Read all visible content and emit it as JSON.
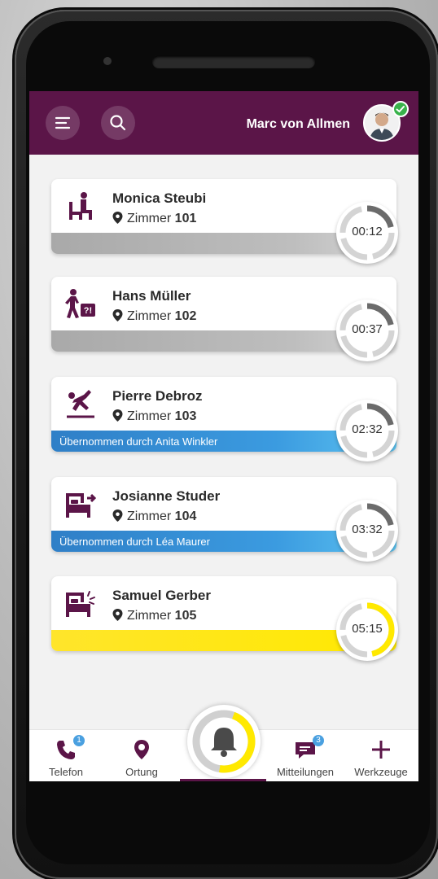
{
  "header": {
    "user_name": "Marc von Allmen",
    "menu_icon": "menu-icon",
    "search_icon": "search-icon",
    "status": "online"
  },
  "colors": {
    "brand": "#5b1548",
    "gray_bar": "#b0b0b0",
    "blue_bar": "#3b9be0",
    "yellow_bar": "#ffe900",
    "online": "#38b24a"
  },
  "alarms": [
    {
      "name": "Monica Steubi",
      "room_label": "Zimmer",
      "room_number": "101",
      "timer": "00:12",
      "status_text": "",
      "icon": "sitting-person-icon"
    },
    {
      "name": "Hans Müller",
      "room_label": "Zimmer",
      "room_number": "102",
      "timer": "00:37",
      "status_text": "",
      "icon": "walking-person-icon"
    },
    {
      "name": "Pierre Debroz",
      "room_label": "Zimmer",
      "room_number": "103",
      "timer": "02:32",
      "status_text": "Übernommen durch Anita Winkler",
      "icon": "fall-person-icon"
    },
    {
      "name": "Josianne Studer",
      "room_label": "Zimmer",
      "room_number": "104",
      "timer": "03:32",
      "status_text": "Übernommen durch Léa Maurer",
      "icon": "bed-exit-icon"
    },
    {
      "name": "Samuel Gerber",
      "room_label": "Zimmer",
      "room_number": "105",
      "timer": "05:15",
      "status_text": "",
      "icon": "bed-alert-icon"
    }
  ],
  "tabs": [
    {
      "label": "Telefon",
      "icon": "phone-icon",
      "badge": "1"
    },
    {
      "label": "Ortung",
      "icon": "location-icon",
      "badge": ""
    },
    {
      "label": "",
      "icon": "alarm-bell-icon",
      "badge": ""
    },
    {
      "label": "Mitteilungen",
      "icon": "message-icon",
      "badge": "3"
    },
    {
      "label": "Werkzeuge",
      "icon": "plus-icon",
      "badge": ""
    }
  ]
}
